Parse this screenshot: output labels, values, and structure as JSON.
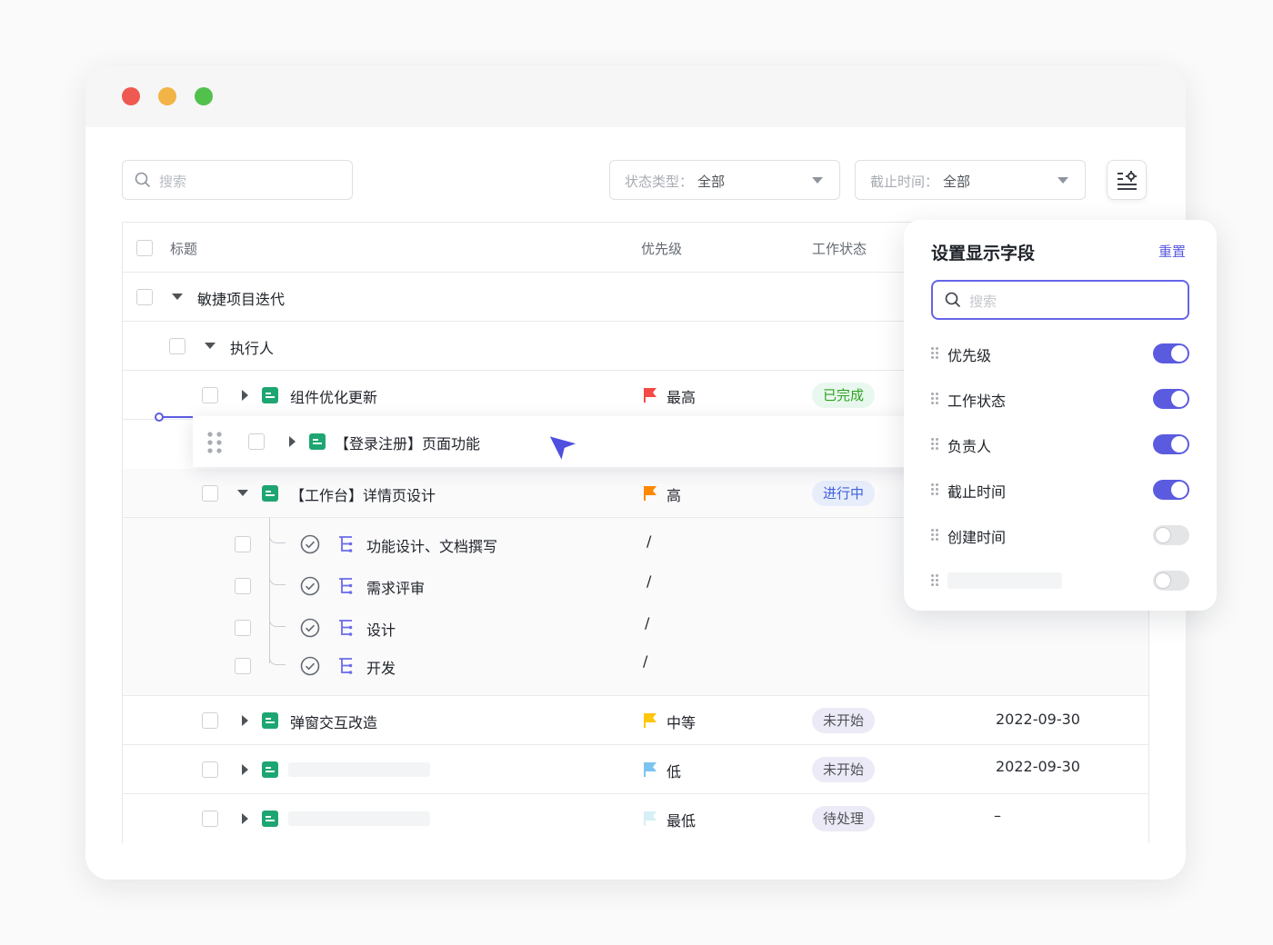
{
  "toolbar": {
    "search_placeholder": "搜索",
    "status_filter": {
      "label": "状态类型：",
      "value": "全部"
    },
    "deadline_filter": {
      "label": "截止时间：",
      "value": "全部"
    }
  },
  "table": {
    "headers": {
      "title": "标题",
      "priority": "优先级",
      "status": "工作状态"
    },
    "group": "敏捷项目迭代",
    "subgroup": "执行人",
    "rows": [
      {
        "title": "组件优化更新",
        "priority": "最高",
        "status": "已完成",
        "date": ""
      },
      {
        "title": "【登录注册】页面功能",
        "priority": "",
        "status": "",
        "date": ""
      },
      {
        "title": "【工作台】详情页设计",
        "priority": "高",
        "status": "进行中",
        "date": ""
      },
      {
        "title": "弹窗交互改造",
        "priority": "中等",
        "status": "未开始",
        "date": "2022-09-30"
      },
      {
        "title": "",
        "priority": "低",
        "status": "未开始",
        "date": "2022-09-30"
      },
      {
        "title": "",
        "priority": "最低",
        "status": "待处理",
        "date": "–"
      }
    ],
    "subtasks": [
      {
        "title": "功能设计、文档撰写",
        "priority": "/"
      },
      {
        "title": "需求评审",
        "priority": "/"
      },
      {
        "title": "设计",
        "priority": "/"
      },
      {
        "title": "开发",
        "priority": "/"
      }
    ]
  },
  "panel": {
    "title": "设置显示字段",
    "reset": "重置",
    "search_placeholder": "搜索",
    "fields": [
      {
        "name": "优先级",
        "enabled": true
      },
      {
        "name": "工作状态",
        "enabled": true
      },
      {
        "name": "负责人",
        "enabled": true
      },
      {
        "name": "截止时间",
        "enabled": true
      },
      {
        "name": "创建时间",
        "enabled": false
      },
      {
        "name": "",
        "enabled": false
      }
    ]
  },
  "colors": {
    "accent": "#5b5be0",
    "flag_highest": "#f54a45",
    "flag_high": "#ff8800",
    "flag_medium": "#ffc60a",
    "flag_low": "#7cc4f0",
    "flag_lowest": "#d6f0f5",
    "badge_done_bg": "#e9f8ef",
    "badge_done_text": "#2ea121",
    "badge_progress_bg": "#e8edfb",
    "badge_progress_text": "#3e63dd",
    "badge_pending_bg": "#eceaf6",
    "badge_pending_text": "#4e5358"
  }
}
